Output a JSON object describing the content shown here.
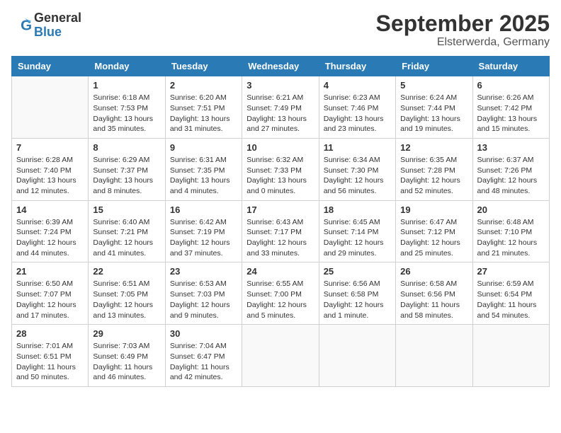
{
  "logo": {
    "general": "General",
    "blue": "Blue"
  },
  "title": {
    "month": "September 2025",
    "location": "Elsterwerda, Germany"
  },
  "weekdays": [
    "Sunday",
    "Monday",
    "Tuesday",
    "Wednesday",
    "Thursday",
    "Friday",
    "Saturday"
  ],
  "weeks": [
    [
      {
        "day": "",
        "sunrise": "",
        "sunset": "",
        "daylight": ""
      },
      {
        "day": "1",
        "sunrise": "Sunrise: 6:18 AM",
        "sunset": "Sunset: 7:53 PM",
        "daylight": "Daylight: 13 hours and 35 minutes."
      },
      {
        "day": "2",
        "sunrise": "Sunrise: 6:20 AM",
        "sunset": "Sunset: 7:51 PM",
        "daylight": "Daylight: 13 hours and 31 minutes."
      },
      {
        "day": "3",
        "sunrise": "Sunrise: 6:21 AM",
        "sunset": "Sunset: 7:49 PM",
        "daylight": "Daylight: 13 hours and 27 minutes."
      },
      {
        "day": "4",
        "sunrise": "Sunrise: 6:23 AM",
        "sunset": "Sunset: 7:46 PM",
        "daylight": "Daylight: 13 hours and 23 minutes."
      },
      {
        "day": "5",
        "sunrise": "Sunrise: 6:24 AM",
        "sunset": "Sunset: 7:44 PM",
        "daylight": "Daylight: 13 hours and 19 minutes."
      },
      {
        "day": "6",
        "sunrise": "Sunrise: 6:26 AM",
        "sunset": "Sunset: 7:42 PM",
        "daylight": "Daylight: 13 hours and 15 minutes."
      }
    ],
    [
      {
        "day": "7",
        "sunrise": "Sunrise: 6:28 AM",
        "sunset": "Sunset: 7:40 PM",
        "daylight": "Daylight: 13 hours and 12 minutes."
      },
      {
        "day": "8",
        "sunrise": "Sunrise: 6:29 AM",
        "sunset": "Sunset: 7:37 PM",
        "daylight": "Daylight: 13 hours and 8 minutes."
      },
      {
        "day": "9",
        "sunrise": "Sunrise: 6:31 AM",
        "sunset": "Sunset: 7:35 PM",
        "daylight": "Daylight: 13 hours and 4 minutes."
      },
      {
        "day": "10",
        "sunrise": "Sunrise: 6:32 AM",
        "sunset": "Sunset: 7:33 PM",
        "daylight": "Daylight: 13 hours and 0 minutes."
      },
      {
        "day": "11",
        "sunrise": "Sunrise: 6:34 AM",
        "sunset": "Sunset: 7:30 PM",
        "daylight": "Daylight: 12 hours and 56 minutes."
      },
      {
        "day": "12",
        "sunrise": "Sunrise: 6:35 AM",
        "sunset": "Sunset: 7:28 PM",
        "daylight": "Daylight: 12 hours and 52 minutes."
      },
      {
        "day": "13",
        "sunrise": "Sunrise: 6:37 AM",
        "sunset": "Sunset: 7:26 PM",
        "daylight": "Daylight: 12 hours and 48 minutes."
      }
    ],
    [
      {
        "day": "14",
        "sunrise": "Sunrise: 6:39 AM",
        "sunset": "Sunset: 7:24 PM",
        "daylight": "Daylight: 12 hours and 44 minutes."
      },
      {
        "day": "15",
        "sunrise": "Sunrise: 6:40 AM",
        "sunset": "Sunset: 7:21 PM",
        "daylight": "Daylight: 12 hours and 41 minutes."
      },
      {
        "day": "16",
        "sunrise": "Sunrise: 6:42 AM",
        "sunset": "Sunset: 7:19 PM",
        "daylight": "Daylight: 12 hours and 37 minutes."
      },
      {
        "day": "17",
        "sunrise": "Sunrise: 6:43 AM",
        "sunset": "Sunset: 7:17 PM",
        "daylight": "Daylight: 12 hours and 33 minutes."
      },
      {
        "day": "18",
        "sunrise": "Sunrise: 6:45 AM",
        "sunset": "Sunset: 7:14 PM",
        "daylight": "Daylight: 12 hours and 29 minutes."
      },
      {
        "day": "19",
        "sunrise": "Sunrise: 6:47 AM",
        "sunset": "Sunset: 7:12 PM",
        "daylight": "Daylight: 12 hours and 25 minutes."
      },
      {
        "day": "20",
        "sunrise": "Sunrise: 6:48 AM",
        "sunset": "Sunset: 7:10 PM",
        "daylight": "Daylight: 12 hours and 21 minutes."
      }
    ],
    [
      {
        "day": "21",
        "sunrise": "Sunrise: 6:50 AM",
        "sunset": "Sunset: 7:07 PM",
        "daylight": "Daylight: 12 hours and 17 minutes."
      },
      {
        "day": "22",
        "sunrise": "Sunrise: 6:51 AM",
        "sunset": "Sunset: 7:05 PM",
        "daylight": "Daylight: 12 hours and 13 minutes."
      },
      {
        "day": "23",
        "sunrise": "Sunrise: 6:53 AM",
        "sunset": "Sunset: 7:03 PM",
        "daylight": "Daylight: 12 hours and 9 minutes."
      },
      {
        "day": "24",
        "sunrise": "Sunrise: 6:55 AM",
        "sunset": "Sunset: 7:00 PM",
        "daylight": "Daylight: 12 hours and 5 minutes."
      },
      {
        "day": "25",
        "sunrise": "Sunrise: 6:56 AM",
        "sunset": "Sunset: 6:58 PM",
        "daylight": "Daylight: 12 hours and 1 minute."
      },
      {
        "day": "26",
        "sunrise": "Sunrise: 6:58 AM",
        "sunset": "Sunset: 6:56 PM",
        "daylight": "Daylight: 11 hours and 58 minutes."
      },
      {
        "day": "27",
        "sunrise": "Sunrise: 6:59 AM",
        "sunset": "Sunset: 6:54 PM",
        "daylight": "Daylight: 11 hours and 54 minutes."
      }
    ],
    [
      {
        "day": "28",
        "sunrise": "Sunrise: 7:01 AM",
        "sunset": "Sunset: 6:51 PM",
        "daylight": "Daylight: 11 hours and 50 minutes."
      },
      {
        "day": "29",
        "sunrise": "Sunrise: 7:03 AM",
        "sunset": "Sunset: 6:49 PM",
        "daylight": "Daylight: 11 hours and 46 minutes."
      },
      {
        "day": "30",
        "sunrise": "Sunrise: 7:04 AM",
        "sunset": "Sunset: 6:47 PM",
        "daylight": "Daylight: 11 hours and 42 minutes."
      },
      {
        "day": "",
        "sunrise": "",
        "sunset": "",
        "daylight": ""
      },
      {
        "day": "",
        "sunrise": "",
        "sunset": "",
        "daylight": ""
      },
      {
        "day": "",
        "sunrise": "",
        "sunset": "",
        "daylight": ""
      },
      {
        "day": "",
        "sunrise": "",
        "sunset": "",
        "daylight": ""
      }
    ]
  ]
}
